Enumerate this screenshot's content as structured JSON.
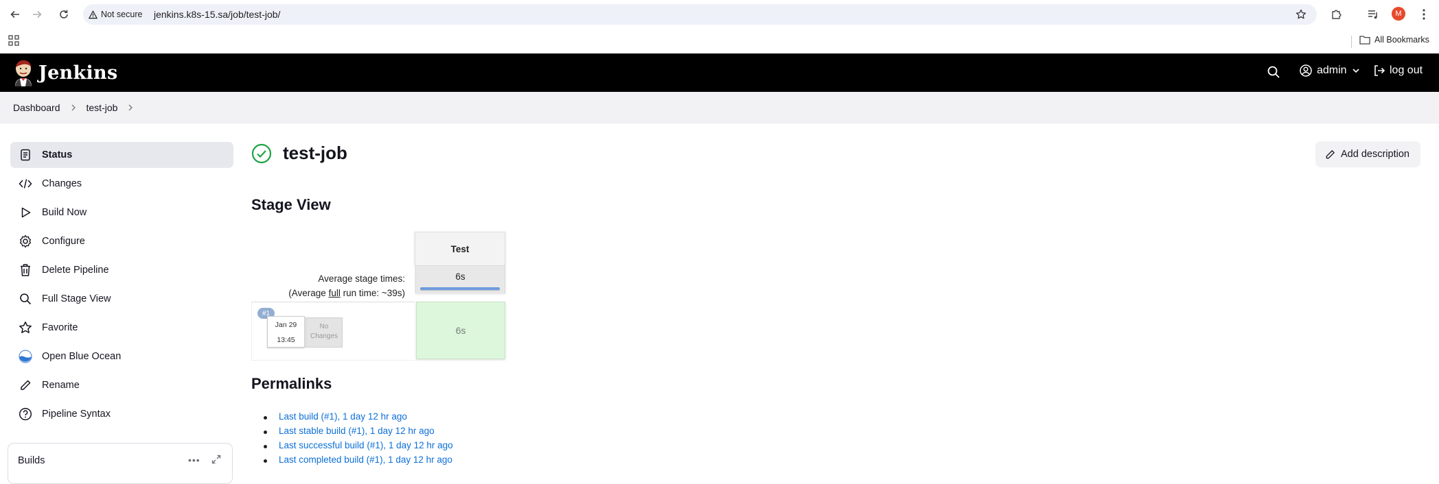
{
  "browser": {
    "security_label": "Not secure",
    "url": "jenkins.k8s-15.sa/job/test-job/",
    "profile_initial": "M",
    "all_bookmarks": "All Bookmarks"
  },
  "header": {
    "title": "Jenkins",
    "user": "admin",
    "logout": "log out"
  },
  "breadcrumb": [
    "Dashboard",
    "test-job"
  ],
  "sidebar": {
    "items": [
      {
        "label": "Status",
        "icon": "document-icon"
      },
      {
        "label": "Changes",
        "icon": "code-icon"
      },
      {
        "label": "Build Now",
        "icon": "play-icon"
      },
      {
        "label": "Configure",
        "icon": "gear-icon"
      },
      {
        "label": "Delete Pipeline",
        "icon": "trash-icon"
      },
      {
        "label": "Full Stage View",
        "icon": "search-icon"
      },
      {
        "label": "Favorite",
        "icon": "star-icon"
      },
      {
        "label": "Open Blue Ocean",
        "icon": "blue-ocean-icon"
      },
      {
        "label": "Rename",
        "icon": "pencil-icon"
      },
      {
        "label": "Pipeline Syntax",
        "icon": "help-icon"
      }
    ],
    "builds_title": "Builds"
  },
  "main": {
    "job_title": "test-job",
    "add_description": "Add description",
    "stage_view_title": "Stage View",
    "stage_view": {
      "stage_name": "Test",
      "avg_label": "Average stage times:",
      "avg_full_prefix": "(Average ",
      "avg_full_word": "full",
      "avg_full_suffix": " run time: ~39s)",
      "avg_stage_time": "6s",
      "build_badge": "#1",
      "build_date": "Jan 29",
      "build_time": "13:45",
      "no_changes_line1": "No",
      "no_changes_line2": "Changes",
      "stage_result": "6s",
      "stage_status_color": "#dcf7dc"
    },
    "permalinks_title": "Permalinks",
    "permalinks": [
      "Last build (#1), 1 day 12 hr ago",
      "Last stable build (#1), 1 day 12 hr ago",
      "Last successful build (#1), 1 day 12 hr ago",
      "Last completed build (#1), 1 day 12 hr ago"
    ]
  }
}
